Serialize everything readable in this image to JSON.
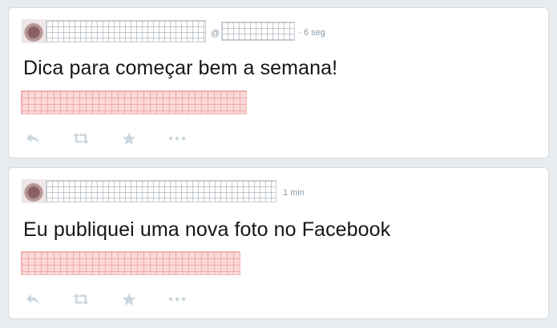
{
  "colors": {
    "meta": "#8899a6",
    "text": "#14171a",
    "icon": "#ccd6dd",
    "redaction_pink": "#fbd9d8"
  },
  "tweets": [
    {
      "handle_prefix": "@",
      "separator": "·",
      "time": "6 seg",
      "text": "Dica para começar bem a semana!",
      "actions": [
        "reply-icon",
        "retweet-icon",
        "favorite-icon",
        "more-icon"
      ]
    },
    {
      "time": "1 min",
      "text": "Eu publiquei uma nova foto no Facebook",
      "actions": [
        "reply-icon",
        "retweet-icon",
        "favorite-icon",
        "more-icon"
      ]
    }
  ]
}
